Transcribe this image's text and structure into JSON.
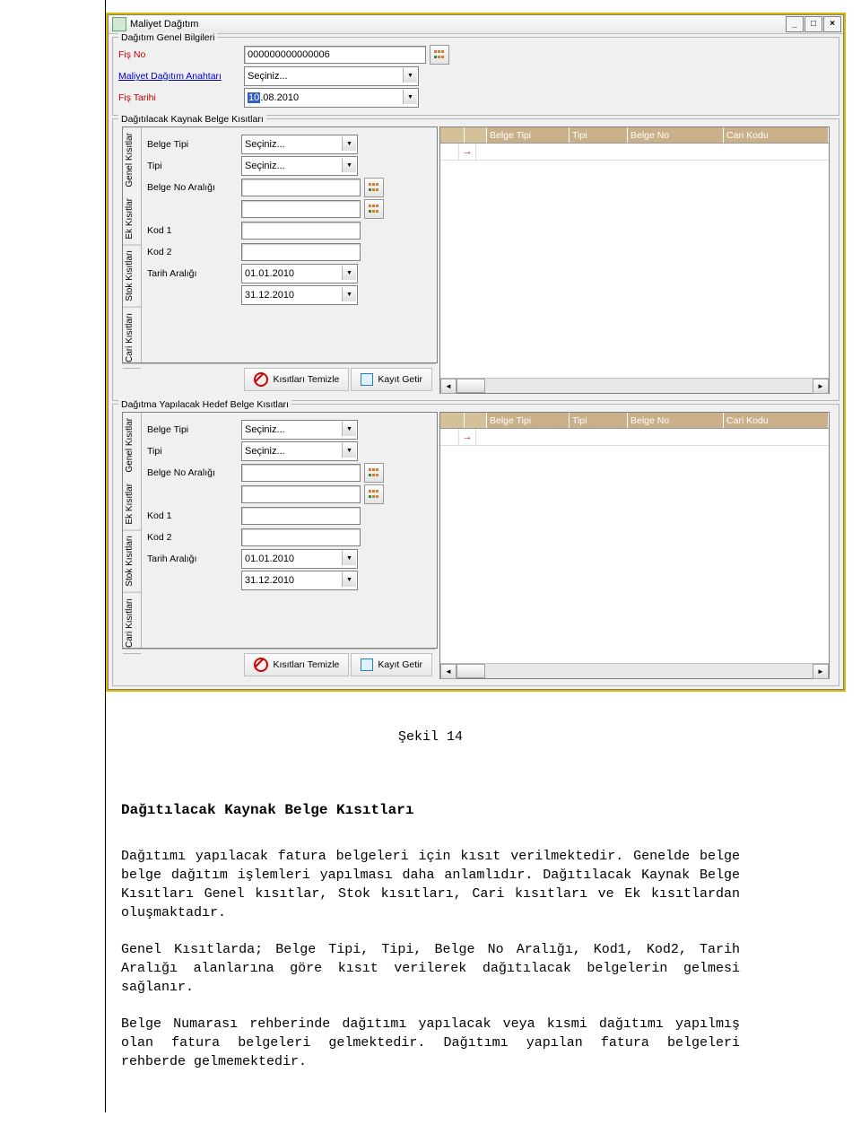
{
  "window": {
    "title": "Maliyet Dağıtım"
  },
  "general": {
    "legend": "Dağıtım Genel Bilgileri",
    "fis_no_label": "Fiş No",
    "fis_no_value": "000000000000006",
    "key_label": "Maliyet Dağıtım Anahtarı",
    "key_value": "Seçiniz...",
    "tarih_label": "Fiş Tarihi",
    "tarih_value": "10.08.2010"
  },
  "source": {
    "legend": "Dağıtılacak Kaynak Belge Kısıtları",
    "tabs": [
      "Genel Kısıtlar",
      "Ek Kısıtlar",
      "Stok Kısıtları",
      "Cari Kısıtları"
    ],
    "belge_tipi_label": "Belge Tipi",
    "belge_tipi_value": "Seçiniz...",
    "tipi_label": "Tipi",
    "tipi_value": "Seçiniz...",
    "belge_no_label": "Belge No Aralığı",
    "kod1_label": "Kod 1",
    "kod2_label": "Kod 2",
    "tarih_label": "Tarih Aralığı",
    "tarih1": "01.01.2010",
    "tarih2": "31.12.2010",
    "clear_btn": "Kısıtları Temizle",
    "fetch_btn": "Kayıt Getir",
    "grid": {
      "cols": [
        "Belge Tipi",
        "Tipi",
        "Belge No",
        "Cari Kodu"
      ]
    }
  },
  "target": {
    "legend": "Dağıtma Yapılacak Hedef Belge Kısıtları",
    "tabs": [
      "Genel Kısıtlar",
      "Ek Kısıtlar",
      "Stok Kısıtları",
      "Cari Kısıtları"
    ],
    "belge_tipi_label": "Belge Tipi",
    "belge_tipi_value": "Seçiniz...",
    "tipi_label": "Tipi",
    "tipi_value": "Seçiniz...",
    "belge_no_label": "Belge No Aralığı",
    "kod1_label": "Kod 1",
    "kod2_label": "Kod 2",
    "tarih_label": "Tarih Aralığı",
    "tarih1": "01.01.2010",
    "tarih2": "31.12.2010",
    "clear_btn": "Kısıtları Temizle",
    "fetch_btn": "Kayıt Getir",
    "grid": {
      "cols": [
        "Belge Tipi",
        "Tipi",
        "Belge No",
        "Cari Kodu"
      ]
    }
  },
  "doc": {
    "caption": "Şekil 14",
    "heading": "Dağıtılacak Kaynak Belge Kısıtları",
    "p1": "Dağıtımı yapılacak fatura belgeleri için kısıt verilmektedir. Genelde belge belge dağıtım işlemleri yapılması daha anlamlıdır. Dağıtılacak Kaynak Belge Kısıtları Genel kısıtlar, Stok kısıtları, Cari kısıtları ve Ek kısıtlardan oluşmaktadır.",
    "p2": "Genel Kısıtlarda; Belge Tipi, Tipi, Belge No Aralığı, Kod1, Kod2, Tarih Aralığı alanlarına göre kısıt verilerek dağıtılacak belgelerin gelmesi sağlanır.",
    "p3": "Belge Numarası rehberinde dağıtımı yapılacak veya kısmi dağıtımı yapılmış olan fatura belgeleri gelmektedir. Dağıtımı yapılan fatura belgeleri rehberde gelmemektedir."
  }
}
